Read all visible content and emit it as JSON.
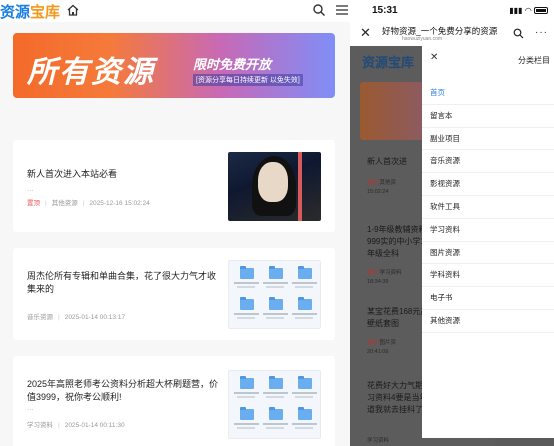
{
  "desktop": {
    "logo_main": "资源",
    "logo_accent": "宝库",
    "icons": [
      "home-icon",
      "search-icon",
      "menu-icon"
    ],
    "banner": {
      "big_text": "所有资源",
      "headline": "限时免费开放",
      "subline": "[资源分享每日持续更新 以免失效]"
    },
    "posts": [
      {
        "title": "新人首次进入本站必看",
        "dots": "...",
        "tag": "置顶",
        "category": "其他资源",
        "date": "2025-12-16 15:02:24"
      },
      {
        "title": "周杰伦所有专辑和单曲合集，花了很大力气才收集来的",
        "dots": "...",
        "tag": "",
        "category": "音乐资源",
        "date": "2025-01-14 00:13:17"
      },
      {
        "title": "2025年高照老师考公资料分析超大杯刷题营，价值3999，祝你考公顺利!",
        "dots": "...",
        "tag": "",
        "category": "学习资料",
        "date": "2025-01-14 00:11:30"
      }
    ]
  },
  "mobile": {
    "time": "15:31",
    "page_title": "好物资源_一个免费分享的资源",
    "page_url": "haowuziyuan.com",
    "logo": "资源宝库",
    "drawer_title": "分类栏目",
    "drawer_items": [
      "首页",
      "留言本",
      "副业项目",
      "音乐资源",
      "影视资源",
      "软件工具",
      "学习资料",
      "图片资源",
      "学科资料",
      "电子书",
      "其他资源"
    ],
    "background_posts": [
      {
        "title": "新人首次进",
        "tag": "置顶",
        "category": "其他资",
        "date": "15:02:24"
      },
      {
        "title": "1-9年级教辅资料999实的中小学1-9年级全科",
        "tag": "置顶",
        "category": "学习资料",
        "date": "18:34:39"
      },
      {
        "title": "某宝花费168元高清壁纸套图",
        "tag": "置顶",
        "category": "图片资",
        "date": "20:41:06"
      },
      {
        "title": "花费好大力气期末复习资料4要是当年知道我就去挂科了",
        "tag": "",
        "category": "学习资料",
        "date": ""
      }
    ]
  }
}
